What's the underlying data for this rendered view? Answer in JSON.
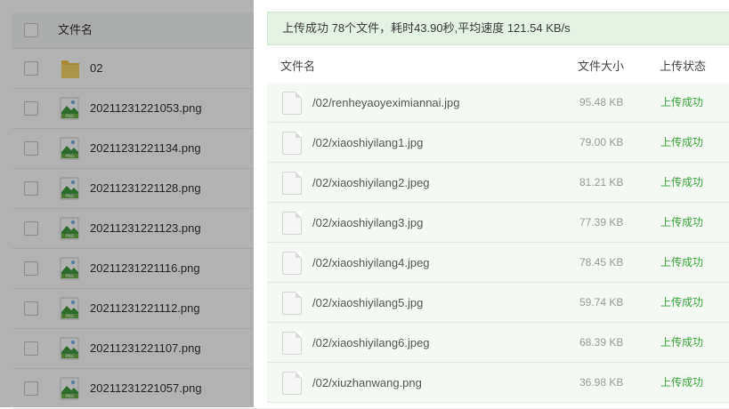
{
  "background": {
    "header": {
      "name_label": "文件名"
    },
    "rows": [
      {
        "name": "02",
        "type": "folder"
      },
      {
        "name": "20211231221053.png",
        "type": "image"
      },
      {
        "name": "20211231221134.png",
        "type": "image"
      },
      {
        "name": "20211231221128.png",
        "type": "image"
      },
      {
        "name": "20211231221123.png",
        "type": "image"
      },
      {
        "name": "20211231221116.png",
        "type": "image"
      },
      {
        "name": "20211231221112.png",
        "type": "image"
      },
      {
        "name": "20211231221107.png",
        "type": "image"
      },
      {
        "name": "20211231221057.png",
        "type": "image"
      }
    ],
    "icon_badge": "PNG"
  },
  "dialog": {
    "banner": "上传成功 78个文件，耗时43.90秒,平均速度 121.54 KB/s",
    "columns": {
      "name": "文件名",
      "size": "文件大小",
      "status": "上传状态"
    },
    "rows": [
      {
        "path": "/02/renheyaoyeximiannai.jpg",
        "size": "95.48 KB",
        "status": "上传成功"
      },
      {
        "path": "/02/xiaoshiyilang1.jpg",
        "size": "79.00 KB",
        "status": "上传成功"
      },
      {
        "path": "/02/xiaoshiyilang2.jpeg",
        "size": "81.21 KB",
        "status": "上传成功"
      },
      {
        "path": "/02/xiaoshiyilang3.jpg",
        "size": "77.39 KB",
        "status": "上传成功"
      },
      {
        "path": "/02/xiaoshiyilang4.jpeg",
        "size": "78.45 KB",
        "status": "上传成功"
      },
      {
        "path": "/02/xiaoshiyilang5.jpg",
        "size": "59.74 KB",
        "status": "上传成功"
      },
      {
        "path": "/02/xiaoshiyilang6.jpeg",
        "size": "68.39 KB",
        "status": "上传成功"
      },
      {
        "path": "/02/xiuzhanwang.png",
        "size": "36.98 KB",
        "status": "上传成功"
      }
    ]
  },
  "colors": {
    "success_text": "#3aa43a",
    "banner_bg": "#e4f2e4",
    "row_bg": "#f4f9f4",
    "overlay": "rgba(0,0,0,0.30)"
  }
}
